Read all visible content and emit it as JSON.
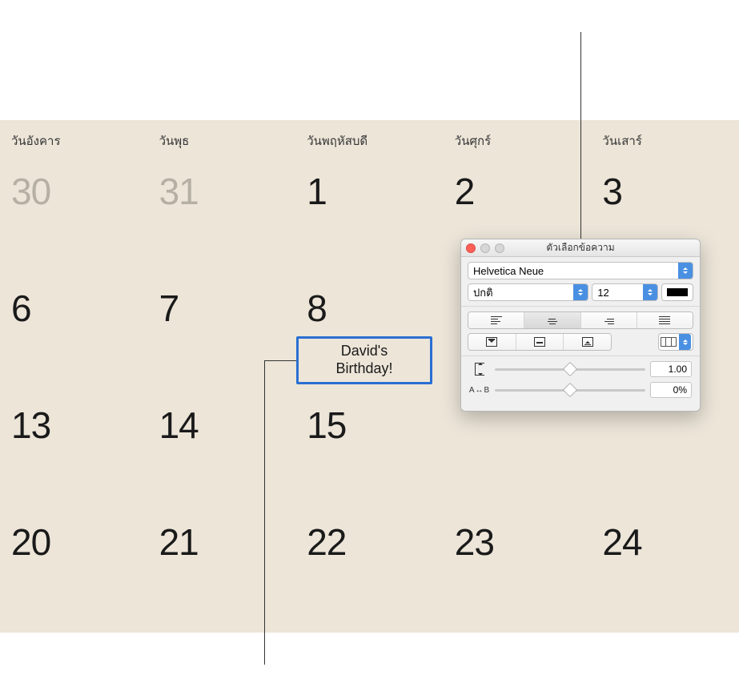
{
  "calendar": {
    "day_headers": [
      "วันอังคาร",
      "วันพุธ",
      "วันพฤหัสบดี",
      "วันศุกร์",
      "วันเสาร์"
    ],
    "rows": [
      [
        {
          "n": "30",
          "muted": true
        },
        {
          "n": "31",
          "muted": true
        },
        {
          "n": "1"
        },
        {
          "n": "2"
        },
        {
          "n": "3"
        }
      ],
      [
        {
          "n": "6"
        },
        {
          "n": "7"
        },
        {
          "n": "8"
        },
        {
          "n": ""
        },
        {
          "n": ""
        }
      ],
      [
        {
          "n": "13"
        },
        {
          "n": "14"
        },
        {
          "n": "15"
        },
        {
          "n": ""
        },
        {
          "n": ""
        }
      ],
      [
        {
          "n": "20"
        },
        {
          "n": "21"
        },
        {
          "n": "22"
        },
        {
          "n": "23"
        },
        {
          "n": "24"
        }
      ]
    ],
    "event_text": "David's\nBirthday!"
  },
  "panel": {
    "title": "ตัวเลือกข้อความ",
    "font_family": "Helvetica Neue",
    "font_style": "ปกติ",
    "font_size": "12",
    "line_spacing": "1.00",
    "char_spacing": "0%",
    "char_spacing_label": "A↔B"
  }
}
